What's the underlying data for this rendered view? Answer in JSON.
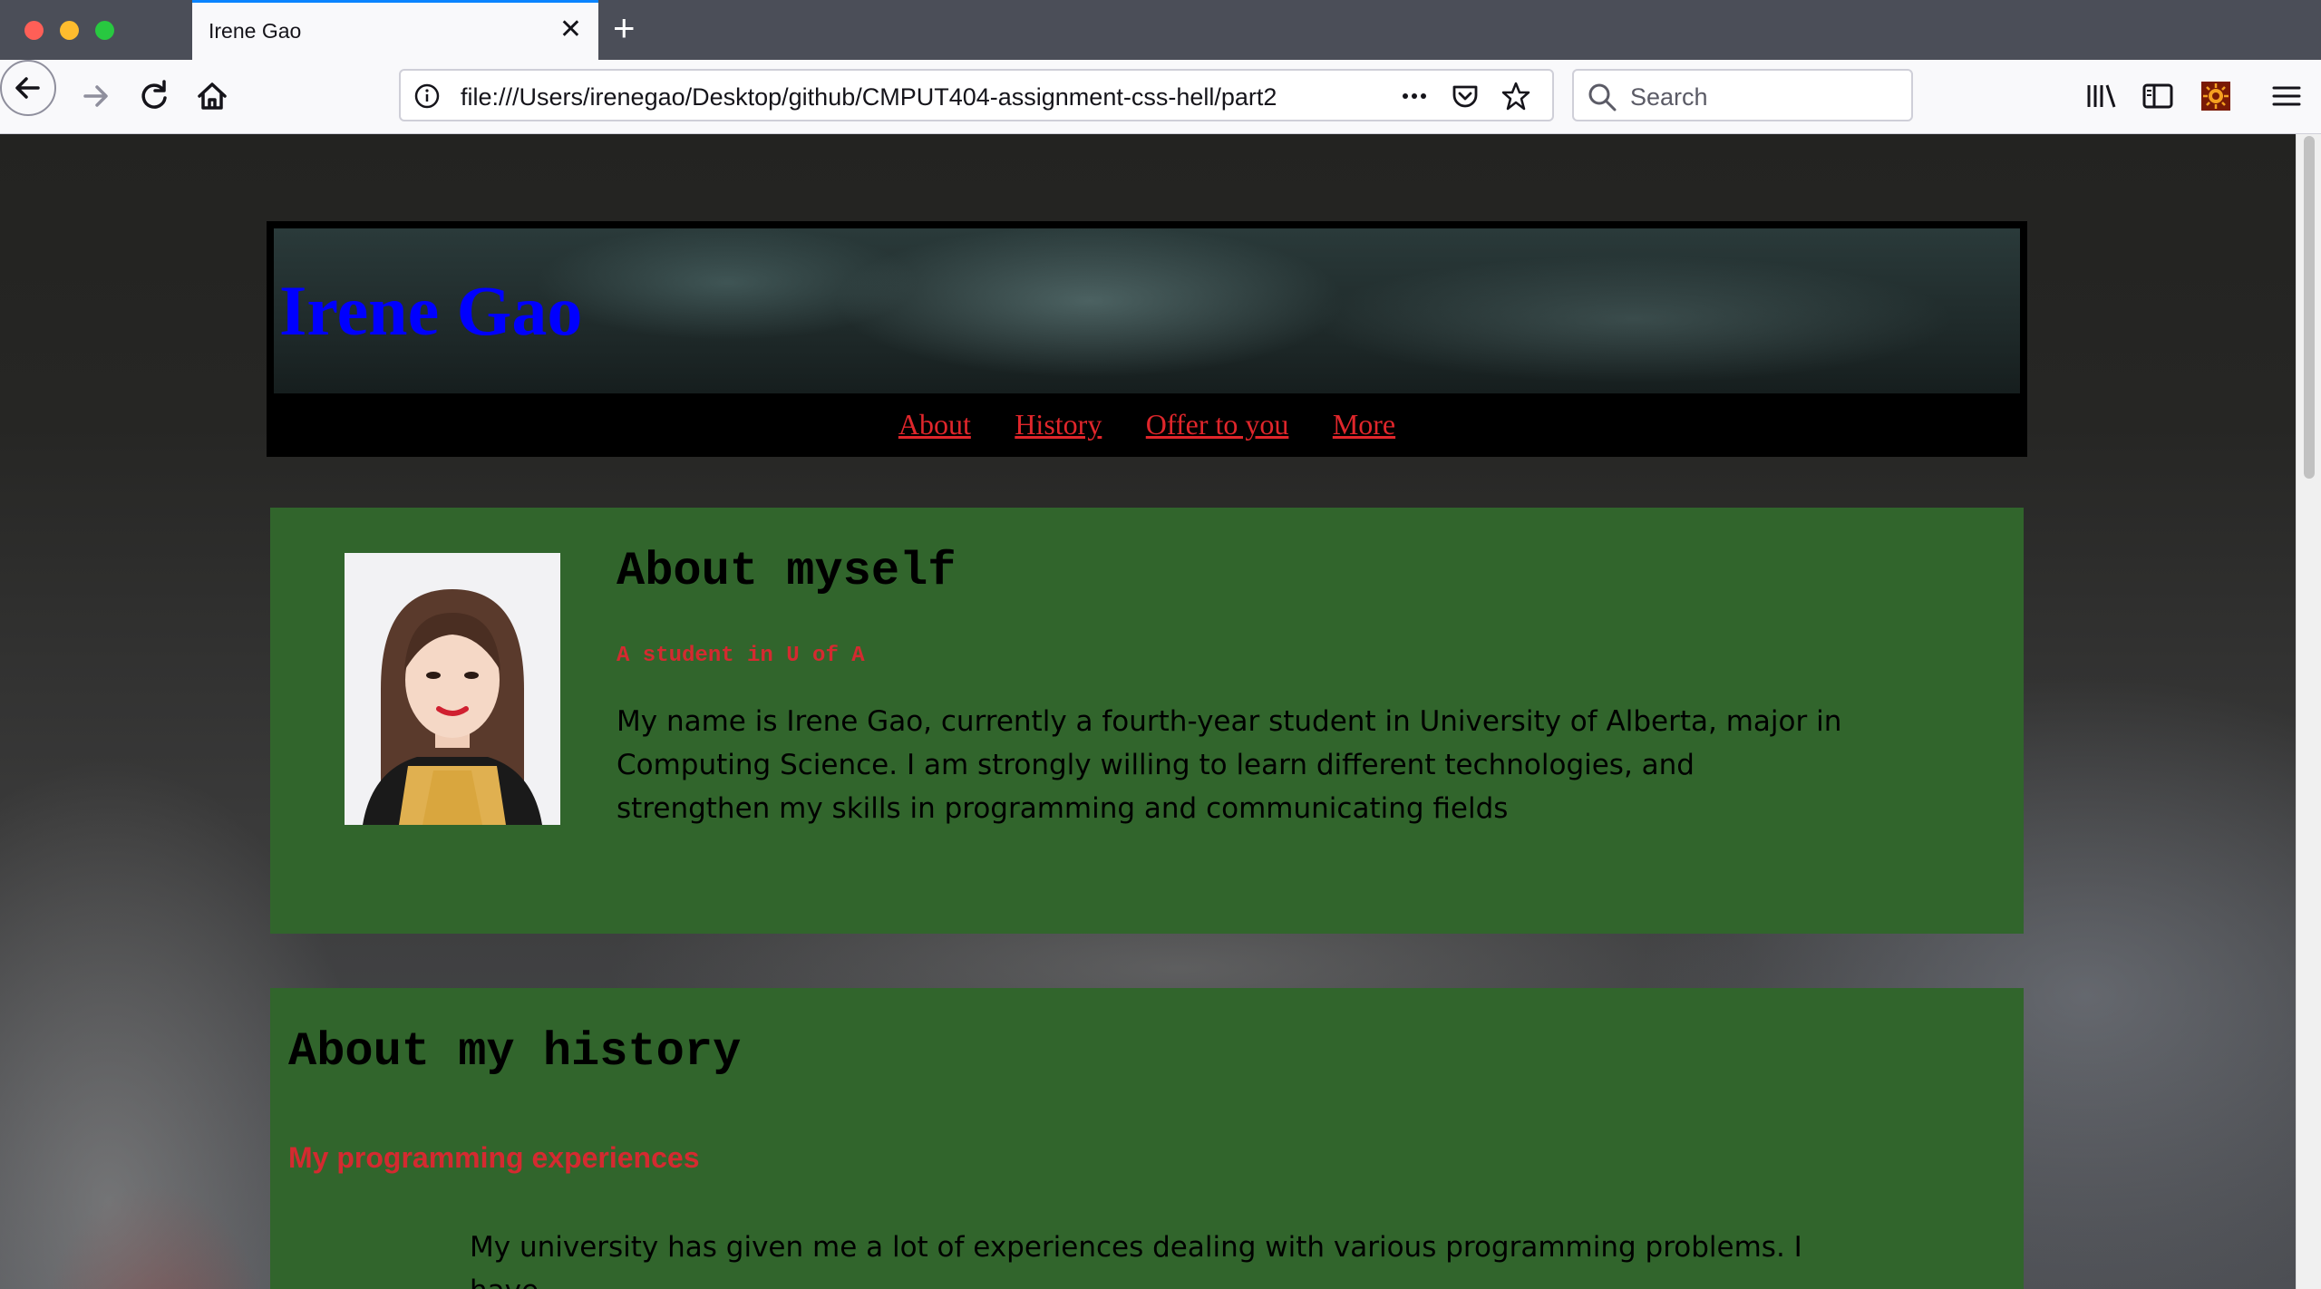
{
  "browser": {
    "tab_title": "Irene Gao",
    "url": "file:///Users/irenegao/Desktop/github/CMPUT404-assignment-css-hell/part2",
    "search_placeholder": "Search"
  },
  "site": {
    "title": "Irene Gao",
    "nav": [
      "About",
      "History",
      "Offer to you",
      "More"
    ],
    "about": {
      "heading": "About myself",
      "subheading": "A student in U of A",
      "paragraph": "My name is Irene Gao, currently a fourth-year student in University of Alberta, major in Computing Science. I am strongly willing to learn different technologies, and strengthen my skills in programming and communicating fields"
    },
    "history": {
      "heading": "About my history",
      "subheading": "My programming experiences",
      "paragraph": "My university has given me a lot of experiences dealing with various programming problems. I have"
    }
  },
  "colors": {
    "title": "#0000ff",
    "nav_link": "#e0262b",
    "section_bg": "#31652c",
    "subheading": "#d42a30"
  }
}
